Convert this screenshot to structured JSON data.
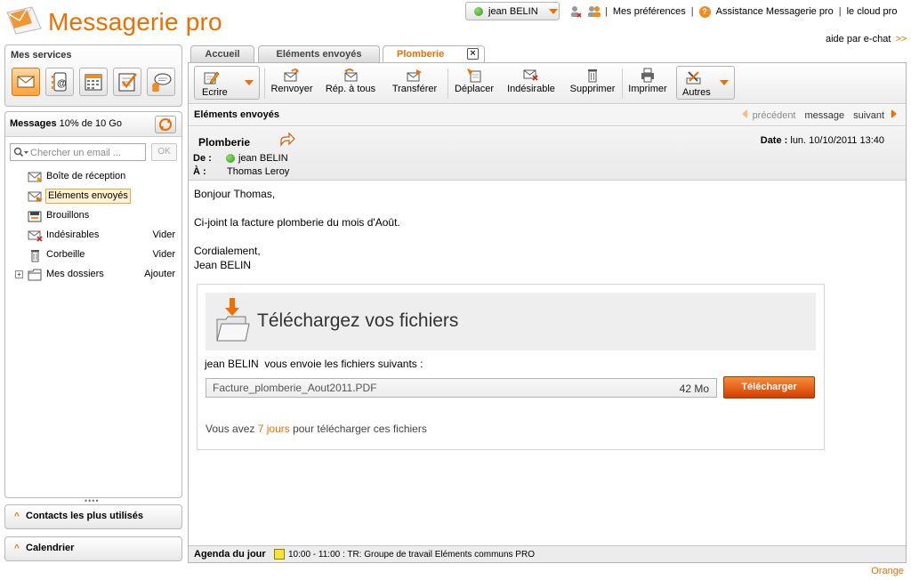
{
  "header": {
    "app_title": "Messagerie pro",
    "user_name": "jean BELIN",
    "links": [
      "Mes préférences",
      "Assistance Messagerie pro",
      "le cloud pro"
    ],
    "chat_label": "aide par e-chat",
    "chat_arrows": ">>"
  },
  "services": {
    "title": "Mes services",
    "items": [
      "mail-icon",
      "contacts-icon",
      "calendar-icon",
      "tasks-icon",
      "chat-icon"
    ]
  },
  "messages_panel": {
    "title": "Messages",
    "quota": "10% de 10 Go",
    "search_placeholder": "Chercher un email ...",
    "search_ok": "OK",
    "folders": [
      {
        "label": "Boîte de réception",
        "action": ""
      },
      {
        "label": "Eléments envoyés",
        "action": "",
        "selected": true
      },
      {
        "label": "Brouillons",
        "action": ""
      },
      {
        "label": "Indésirables",
        "action": "Vider"
      },
      {
        "label": "Corbeille",
        "action": "Vider"
      },
      {
        "label": "Mes dossiers",
        "action": "Ajouter"
      }
    ]
  },
  "accordions": {
    "contacts": "Contacts les plus utilisés",
    "calendar": "Calendrier"
  },
  "tabs": [
    {
      "label": "Accueil"
    },
    {
      "label": "Eléments envoyés"
    },
    {
      "label": "Plomberie",
      "active": true
    }
  ],
  "toolbar": {
    "write": "Ecrire",
    "resend": "Renvoyer",
    "reply_all": "Rép. à tous",
    "forward": "Transférer",
    "move": "Déplacer",
    "spam": "Indésirable",
    "delete": "Supprimer",
    "print": "Imprimer",
    "others": "Autres"
  },
  "subheader": {
    "folder": "Eléments envoyés",
    "prev": "précédent",
    "middle": "message",
    "next": "suivant"
  },
  "message": {
    "subject": "Plomberie",
    "from_label": "De :",
    "from": "jean BELIN",
    "to_label": "À :",
    "to": "Thomas Leroy",
    "date_label": "Date :",
    "date": "lun. 10/10/2011 13:40",
    "body": [
      "Bonjour Thomas,",
      "Ci-joint la facture plomberie du mois d'Août.",
      "Cordialement,",
      "Jean BELIN"
    ]
  },
  "download": {
    "title": "Téléchargez vos fichiers",
    "sender_line": "jean BELIN  vous envoie les fichiers suivants :",
    "file_name": "Facture_plomberie_Aout2011.PDF",
    "file_size": "42 Mo",
    "button": "Télécharger",
    "expiry_prefix": "Vous avez ",
    "expiry_days": "7 jours",
    "expiry_suffix": " pour télécharger ces fichiers"
  },
  "agenda": {
    "label": "Agenda du jour",
    "event": "10:00 - 11:00 : TR: Groupe de travail Eléments communs PRO"
  },
  "footer": {
    "brand": "Orange"
  },
  "colors": {
    "accent": "#f06e00",
    "button": "#e04a00"
  }
}
